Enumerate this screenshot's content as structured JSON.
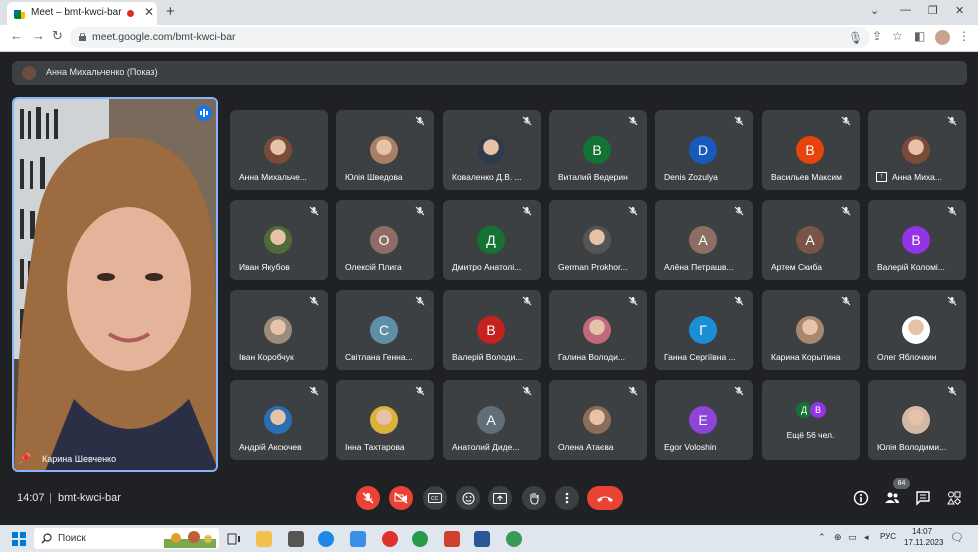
{
  "browser": {
    "tab_title": "Meet – bmt-kwci-bar",
    "url": "meet.google.com/bmt-kwci-bar"
  },
  "meet": {
    "presenting_label": "Анна Михальченко (Показ)",
    "main_speaker": "Карина Шевченко",
    "meeting_time": "14:07",
    "meeting_code": "bmt-kwci-bar",
    "people_count": "84",
    "participants": [
      {
        "name": "Анна Михальче...",
        "initial": "",
        "color": "#7a4b3a",
        "photo": true,
        "muted": false
      },
      {
        "name": "Юлія Шведова",
        "initial": "",
        "color": "#a87f67",
        "photo": true,
        "muted": true
      },
      {
        "name": "Коваленко Д.В. ...",
        "initial": "",
        "color": "#2f3b4d",
        "photo": true,
        "muted": true
      },
      {
        "name": "Виталий Ведерин",
        "initial": "В",
        "color": "#137333",
        "photo": false,
        "muted": true
      },
      {
        "name": "Denis Zozulya",
        "initial": "D",
        "color": "#185abc",
        "photo": false,
        "muted": true
      },
      {
        "name": "Васильев Максим",
        "initial": "В",
        "color": "#e8430a",
        "photo": false,
        "muted": true
      },
      {
        "name": "Анна Миха...",
        "initial": "",
        "color": "#7a4b3a",
        "photo": true,
        "muted": true,
        "presenting": true
      },
      {
        "name": "Иван Якубов",
        "initial": "",
        "color": "#4f6b3a",
        "photo": true,
        "muted": true
      },
      {
        "name": "Олексій Плига",
        "initial": "О",
        "color": "#8d6e63",
        "photo": false,
        "muted": true
      },
      {
        "name": "Дмитро Анатолі...",
        "initial": "Д",
        "color": "#137333",
        "photo": false,
        "muted": true
      },
      {
        "name": "German Prokhor...",
        "initial": "",
        "color": "#555",
        "photo": true,
        "muted": true
      },
      {
        "name": "Алёна Петрашв...",
        "initial": "А",
        "color": "#8d6e63",
        "photo": false,
        "muted": true
      },
      {
        "name": "Артем Скиба",
        "initial": "А",
        "color": "#795548",
        "photo": false,
        "muted": true
      },
      {
        "name": "Валерій Коломі...",
        "initial": "В",
        "color": "#9334e6",
        "photo": false,
        "muted": true
      },
      {
        "name": "Іван Коробчук",
        "initial": "",
        "color": "#9c8b7a",
        "photo": true,
        "muted": true
      },
      {
        "name": "Світлана Генна...",
        "initial": "С",
        "color": "#5f8fa8",
        "photo": false,
        "muted": true
      },
      {
        "name": "Валерій Володи...",
        "initial": "В",
        "color": "#c5221f",
        "photo": false,
        "muted": true
      },
      {
        "name": "Галина Володи...",
        "initial": "",
        "color": "#c06b7b",
        "photo": true,
        "muted": true
      },
      {
        "name": "Ганна Сергіївна ...",
        "initial": "Г",
        "color": "#1a8fd6",
        "photo": false,
        "muted": true
      },
      {
        "name": "Карина Корытина",
        "initial": "",
        "color": "#a8886d",
        "photo": true,
        "muted": true
      },
      {
        "name": "Олег Яблочкин",
        "initial": "",
        "color": "#ffffff",
        "photo": true,
        "muted": true
      },
      {
        "name": "Андрій Аксючев",
        "initial": "",
        "color": "#2b6fb3",
        "photo": true,
        "muted": true
      },
      {
        "name": "Інна Тахтарова",
        "initial": "",
        "color": "#d9b23a",
        "photo": true,
        "muted": true
      },
      {
        "name": "Анатолий Диде...",
        "initial": "А",
        "color": "#5f6e78",
        "photo": false,
        "muted": true
      },
      {
        "name": "Олена Атаєва",
        "initial": "",
        "color": "#8a6e5a",
        "photo": true,
        "muted": true
      },
      {
        "name": "Egor Voloshin",
        "initial": "E",
        "color": "#8e44d6",
        "photo": false,
        "muted": true
      },
      {
        "name": "Ещё 56 чел.",
        "initial": "",
        "color": "",
        "photo": false,
        "muted": false,
        "more": true,
        "more_initials": [
          "Д",
          "В"
        ]
      },
      {
        "name": "Юлія Володими...",
        "initial": "",
        "color": "#d6b8a6",
        "photo": true,
        "muted": true
      }
    ]
  },
  "taskbar": {
    "search_placeholder": "Поиск",
    "language": "РУС",
    "clock_time": "14:07",
    "clock_date": "17.11.2023"
  },
  "colors": {
    "meet_bg": "#202124",
    "tile_bg": "#3c4043",
    "danger": "#ea4335",
    "accent": "#8ab4f8"
  }
}
